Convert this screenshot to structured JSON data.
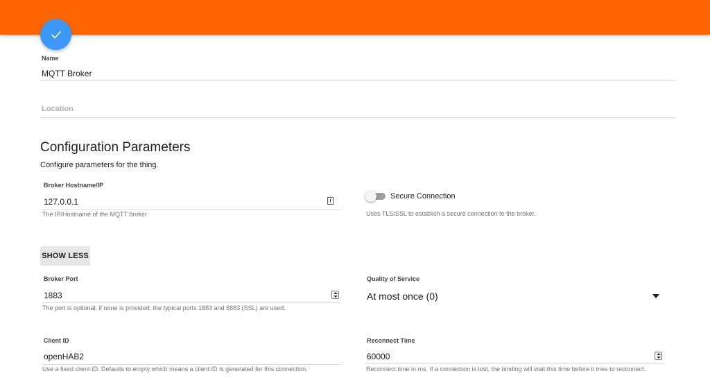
{
  "header": {
    "accent_color": "#ff6600",
    "fab_icon": "check-icon",
    "fab_color": "#3d98f5"
  },
  "thing": {
    "name_label": "Name",
    "name_value": "MQTT Broker",
    "location_placeholder": "Location"
  },
  "config": {
    "title": "Configuration Parameters",
    "description": "Configure parameters for the thing.",
    "broker_host": {
      "label": "Broker Hostname/IP",
      "value": "127.0.0.1",
      "hint": "The IP/Hostname of the MQTT broker",
      "icon": "info-icon"
    },
    "secure": {
      "label": "Secure Connection",
      "hint": "Uses TLS/SSL to establish a secure connection to the broker.",
      "enabled": false
    },
    "show_less_label": "SHOW LESS",
    "broker_port": {
      "label": "Broker Port",
      "value": "1883",
      "hint": "The port is optional, if none is provided, the typical ports 1883 and 8883 (SSL) are used."
    },
    "qos": {
      "label": "Quality of Service",
      "value": "At most once (0)"
    },
    "client_id": {
      "label": "Client ID",
      "value": "openHAB2",
      "hint": "Use a fixed client ID. Defaults to empty which means a client ID is generated for this connection."
    },
    "reconnect": {
      "label": "Reconnect Time",
      "value": "60000",
      "hint": "Reconnect time in ms. If a connection is lost, the binding will wait this time before it tries to reconnect."
    }
  }
}
